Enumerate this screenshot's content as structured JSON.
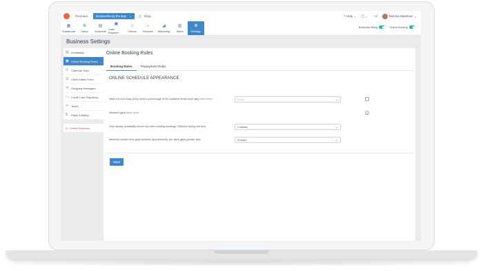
{
  "topbar": {
    "personal": "Personal",
    "location": "Bodyworks by the Bay",
    "shop": "Shop",
    "help": "Help",
    "notifications_count": "0",
    "user_name": "Martina Martinavi"
  },
  "nav": {
    "items": [
      {
        "label": "Dashboard",
        "icon": "grid-icon"
      },
      {
        "label": "Setup",
        "icon": "wrench-icon"
      },
      {
        "label": "Schedule",
        "icon": "calendar-icon"
      },
      {
        "label": "Cash Register",
        "icon": "register-icon"
      },
      {
        "label": "Clients",
        "icon": "clients-icon"
      },
      {
        "label": "Reviews",
        "icon": "star-icon"
      },
      {
        "label": "Marketing",
        "icon": "megaphone-icon"
      },
      {
        "label": "Sales",
        "icon": "chart-icon"
      },
      {
        "label": "Settings",
        "icon": "gear-icon"
      }
    ],
    "active": "Settings",
    "business_listing": "Business listing",
    "online_booking": "Online booking"
  },
  "page": {
    "title": "Business Settings"
  },
  "sidebar": {
    "items": [
      {
        "label": "Availability"
      },
      {
        "label": "Online Booking Rules"
      },
      {
        "label": "Calendar Sync"
      },
      {
        "label": "Client Intake Form"
      },
      {
        "label": "Outgoing Messages"
      },
      {
        "label": "Credit Card Payments"
      },
      {
        "label": "Taxes"
      },
      {
        "label": "Plans & Billing"
      }
    ],
    "active": "Online Booking Rules",
    "delete": "Delete Business"
  },
  "main": {
    "title": "Online Booking Rules",
    "tabs": [
      "Booking Rules",
      "Prepayment Rules"
    ],
    "section_title": "ONLINE SCHEDULE APPEARANCE",
    "rows": [
      {
        "label": "Make me look busy (Only show a percentage of the available times each day)",
        "link": "learn more",
        "value": "100%",
        "disabled": true,
        "checked": false
      },
      {
        "label": "Minimize gaps",
        "link": "learn more",
        "checked": true
      },
      {
        "label": "Only display availability before and after existing bookings. Effective during the next",
        "value": "2 weeks"
      },
      {
        "label": "Minimize smaller time gaps between appointments, but allow gaps greater than",
        "value": "3 hours"
      }
    ],
    "save": "Save"
  }
}
